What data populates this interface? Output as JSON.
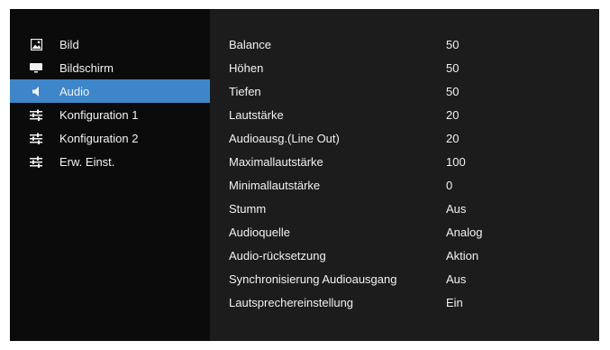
{
  "sidebar": {
    "items": [
      {
        "label": "Bild",
        "icon": "picture-icon"
      },
      {
        "label": "Bildschirm",
        "icon": "screen-icon"
      },
      {
        "label": "Audio",
        "icon": "speaker-icon"
      },
      {
        "label": "Konfiguration 1",
        "icon": "sliders-icon"
      },
      {
        "label": "Konfiguration 2",
        "icon": "sliders-icon"
      },
      {
        "label": "Erw. Einst.",
        "icon": "sliders-icon"
      }
    ],
    "active_index": 2
  },
  "settings": {
    "rows": [
      {
        "label": "Balance",
        "value": "50"
      },
      {
        "label": "Höhen",
        "value": "50"
      },
      {
        "label": "Tiefen",
        "value": "50"
      },
      {
        "label": "Lautstärke",
        "value": "20"
      },
      {
        "label": "Audioausg.(Line Out)",
        "value": "20"
      },
      {
        "label": "Maximallautstärke",
        "value": "100"
      },
      {
        "label": "Minimallautstärke",
        "value": "0"
      },
      {
        "label": "Stumm",
        "value": "Aus"
      },
      {
        "label": "Audioquelle",
        "value": "Analog"
      },
      {
        "label": "Audio-rücksetzung",
        "value": "Aktion"
      },
      {
        "label": "Synchronisierung Audioausgang",
        "value": "Aus"
      },
      {
        "label": "Lautsprechereinstellung",
        "value": "Ein"
      }
    ]
  },
  "colors": {
    "panel_bg": "#0b0b0b",
    "main_bg": "#1c1c1c",
    "active_bg": "#3e86c9",
    "text": "#f2f2f2"
  }
}
